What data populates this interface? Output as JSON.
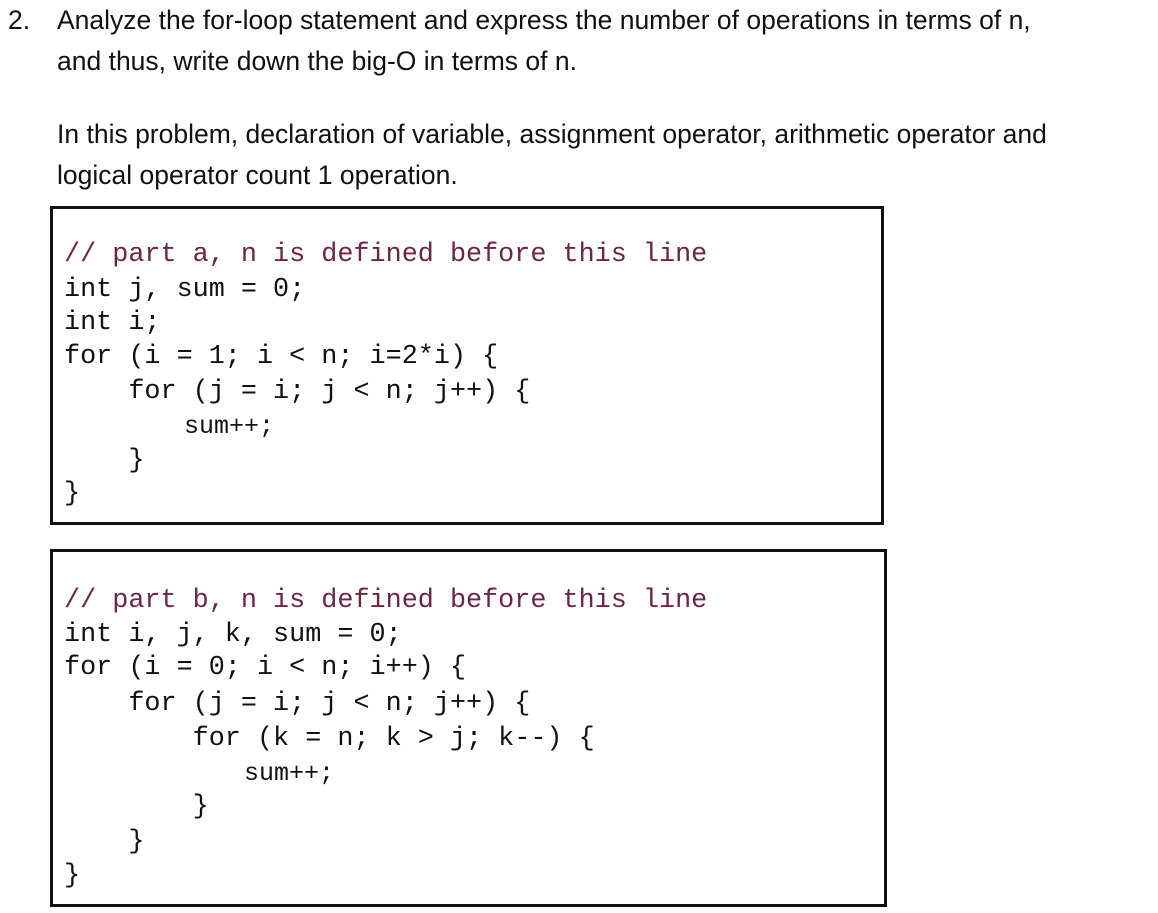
{
  "question": {
    "number": "2.",
    "lines": [
      "Analyze the for-loop statement and express the number of operations in terms of n,",
      "and thus, write down the big-O in terms of n.",
      "In this problem, declaration of variable, assignment operator, arithmetic operator and",
      "logical operator count 1 operation."
    ]
  },
  "colors": {
    "comment": "#6e2447",
    "text": "#111111",
    "border": "#111111"
  },
  "code_blocks": [
    {
      "label": "part a",
      "lines": [
        "// part a, n is defined before this line",
        "int j, sum = 0;",
        "int i;",
        "for (i = 1; i < n; i=2*i) {",
        "    for (j = i; j < n; j++) {",
        "        sum++;",
        "    }",
        "}"
      ]
    },
    {
      "label": "part b",
      "lines": [
        "// part b, n is defined before this line",
        "int i, j, k, sum = 0;",
        "for (i = 0; i < n; i++) {",
        "    for (j = i; j < n; j++) {",
        "        for (k = n; k > j; k--) {",
        "            sum++;",
        "        }",
        "    }",
        "}"
      ]
    }
  ]
}
